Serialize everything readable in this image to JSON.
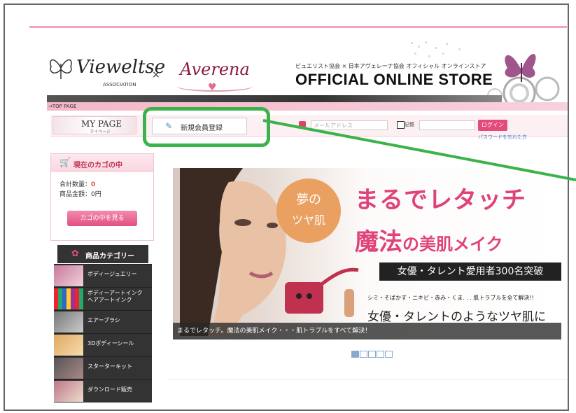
{
  "header": {
    "logo_left": "Vieweltse",
    "logo_left_sub": "ASSOCIATION",
    "logo_times": "×",
    "logo_right": "Averena",
    "store_subtitle": "ビュエリスト協会 × 日本アヴェレーナ協会 オフィシャル オンラインストア",
    "store_title": "OFFICIAL ONLINE STORE",
    "top_page_link": "→TOP PAGE"
  },
  "nav": {
    "mypage_label": "MY PAGE",
    "mypage_sub": "マイページ",
    "register_label": "新規会員登録",
    "email_placeholder": "メールアドレス",
    "remember_label": "記憶",
    "login_label": "ログイン",
    "forgot_label": "パスワードを忘れた方"
  },
  "cart": {
    "title": "現在のカゴの中",
    "count_label": "合計数量：",
    "count_value": "0",
    "amount_label": "商品金額：",
    "amount_value": "0円",
    "view_button": "カゴの中を見る"
  },
  "categories": {
    "title": "商品カテゴリー",
    "items": [
      {
        "label": "ボディージュエリー"
      },
      {
        "label": "ボディーアートインク\nヘアアートインク"
      },
      {
        "label": "エアーブラシ"
      },
      {
        "label": "3Dボディーシール"
      },
      {
        "label": "スターターキット"
      },
      {
        "label": "ダウンロード販売"
      }
    ]
  },
  "banner": {
    "circle_line1": "夢の",
    "circle_line2": "ツヤ肌",
    "headline1": "まるでレタッチ",
    "headline2_big": "魔法",
    "headline2_rest": "の美肌メイク",
    "black_bar": "女優・タレント愛用者300名突破",
    "small_text": "シミ・そばかす・ニキビ・赤み・くま. . . 肌トラブルを全て解決!!",
    "headline3": "女優・タレントのようなツヤ肌に",
    "caption": "まるでレタッチ。魔法の美肌メイク・・・肌トラブルをすべて解決！"
  },
  "slider": {
    "total": 5,
    "active": 1
  },
  "colors": {
    "accent_pink": "#e0427a",
    "highlight_green": "#3bb34a"
  }
}
